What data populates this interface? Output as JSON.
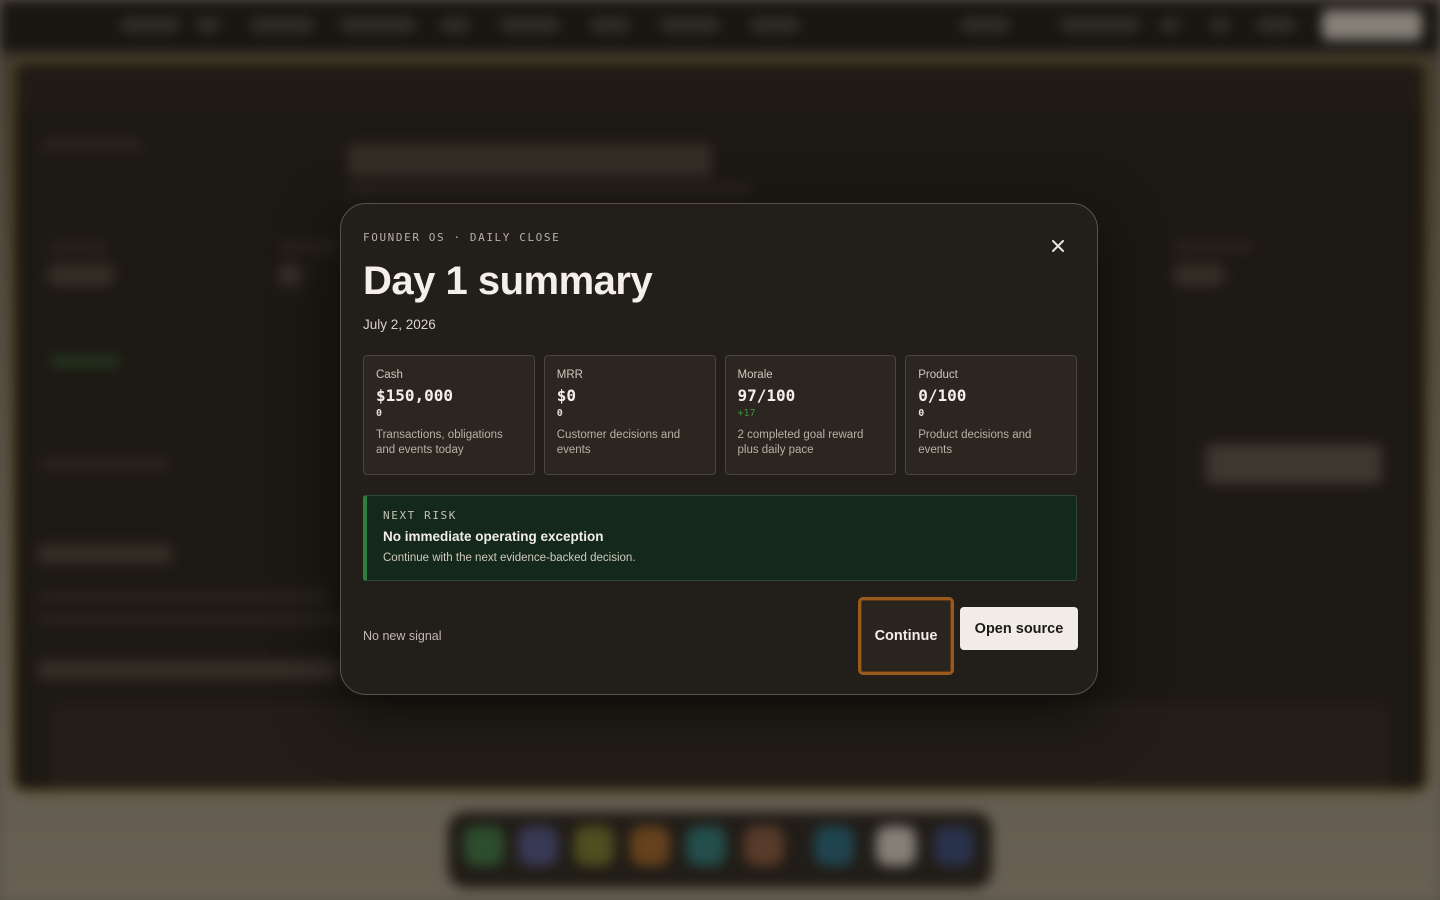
{
  "modal": {
    "eyebrow": "FOUNDER OS · DAILY CLOSE",
    "title": "Day 1 summary",
    "date": "July 2, 2026",
    "close_icon": "close-icon",
    "metrics": [
      {
        "label": "Cash",
        "value": "$150,000",
        "delta": "0",
        "description": "Transactions, obligations and events today"
      },
      {
        "label": "MRR",
        "value": "$0",
        "delta": "0",
        "description": "Customer decisions and events"
      },
      {
        "label": "Morale",
        "value": "97/100",
        "delta": "+17",
        "description": "2 completed goal reward plus daily pace"
      },
      {
        "label": "Product",
        "value": "0/100",
        "delta": "0",
        "description": "Product decisions and events"
      }
    ],
    "risk": {
      "eyebrow": "NEXT RISK",
      "title": "No immediate operating exception",
      "body": "Continue with the next evidence-backed decision."
    },
    "signal": "No new signal",
    "buttons": {
      "continue": "Continue",
      "open_source": "Open source"
    }
  },
  "colors": {
    "modal_bg": "#221e1a",
    "risk_bg": "#15291b",
    "risk_accent": "#2f7d41",
    "positive_delta": "#3f8f3a",
    "focus_ring": "#9a5a1c",
    "primary_button_bg": "#f1ede6"
  }
}
